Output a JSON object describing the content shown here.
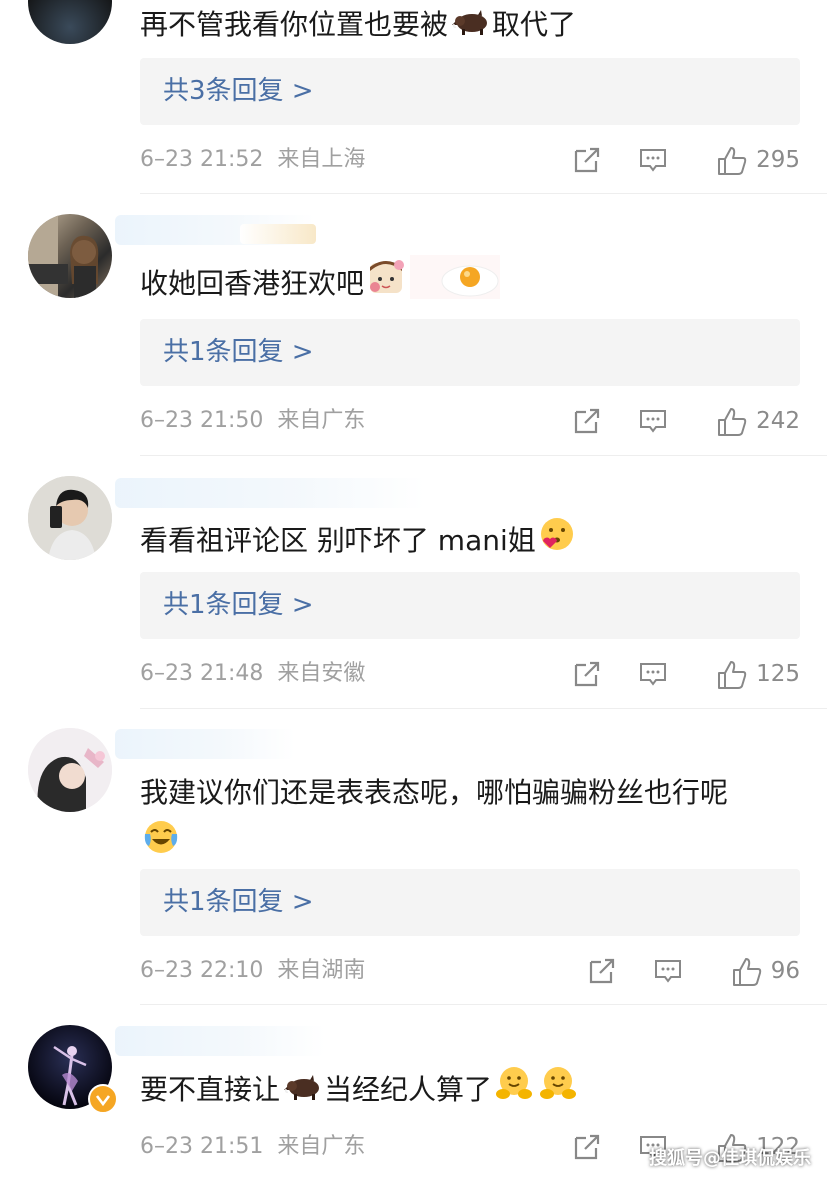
{
  "comments": [
    {
      "text": "再不管我看你位置也要被",
      "text_after": "取代了",
      "reply_label": "共3条回复 >",
      "time": "6–23 21:52",
      "location": "来自上海",
      "likes": "295"
    },
    {
      "text": "收她回香港狂欢吧",
      "text_after": "",
      "reply_label": "共1条回复 >",
      "time": "6–23 21:50",
      "location": "来自广东",
      "likes": "242"
    },
    {
      "text": "看看祖评论区 别吓坏了 mani姐",
      "text_after": "",
      "reply_label": "共1条回复 >",
      "time": "6–23 21:48",
      "location": "来自安徽",
      "likes": "125"
    },
    {
      "text": "我建议你们还是表表态呢，哪怕骗骗粉丝也行呢",
      "text_after": "",
      "reply_label": "共1条回复 >",
      "time": "6–23 22:10",
      "location": "来自湖南",
      "likes": "96"
    },
    {
      "text": "要不直接让",
      "text_after": "当经纪人算了",
      "reply_label": "",
      "time": "6–23 21:51",
      "location": "来自广东",
      "likes": "122"
    }
  ],
  "watermark": "搜狐号@佳琪侃娱乐",
  "icons": {
    "share": "share-icon",
    "comment": "comment-icon",
    "like": "thumb-up-icon"
  },
  "colors": {
    "reply_link": "#4a6fa5",
    "meta_text": "#a0a0a0",
    "reply_bg": "#f4f4f4"
  }
}
